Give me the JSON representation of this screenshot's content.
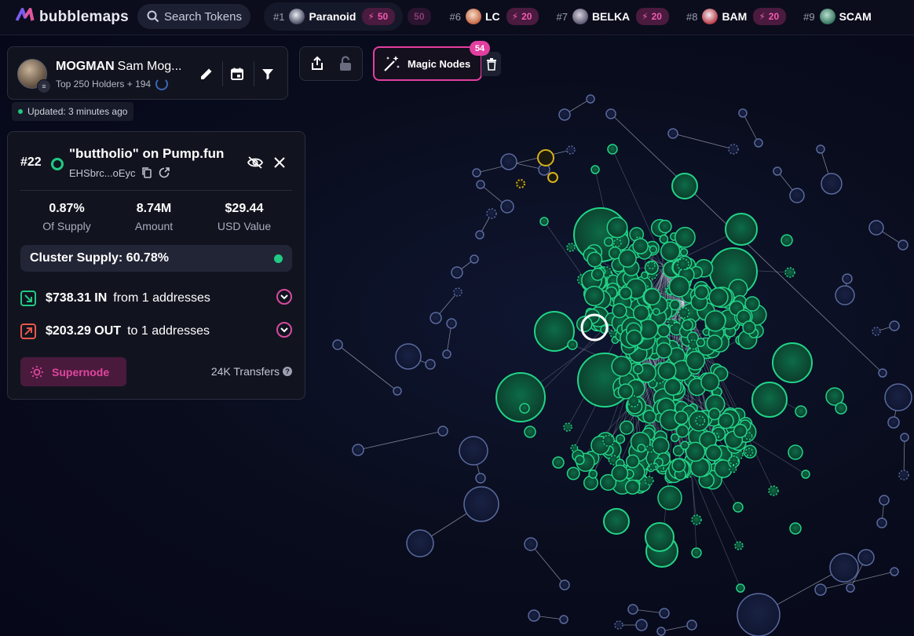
{
  "app": {
    "name": "bubblemaps"
  },
  "search": {
    "placeholder": "Search Tokens"
  },
  "ticker": [
    {
      "rank": "#1",
      "symbol": "Paranoid",
      "boost": "50",
      "ghost": "50",
      "avatar_color": "#dfe2ea"
    },
    {
      "rank": "#6",
      "symbol": "LC",
      "boost": "20",
      "avatar_color": "#f4d2b8"
    },
    {
      "rank": "#7",
      "symbol": "BELKA",
      "boost": "20",
      "avatar_color": "#c9c2d1"
    },
    {
      "rank": "#8",
      "symbol": "BAM",
      "boost": "20",
      "avatar_color": "#e8e2e6"
    },
    {
      "rank": "#9",
      "symbol": "SCAM",
      "boost": "",
      "avatar_color": "#7fb8a1"
    }
  ],
  "profile": {
    "name": "MOGMAN",
    "subtitle": "Sam Mog...",
    "holders_label": "Top 250 Holders + 194",
    "updated": "Updated: 3 minutes ago"
  },
  "magic_nodes": {
    "label": "Magic Nodes",
    "count": "54"
  },
  "detail": {
    "rank": "#22",
    "title": "\"buttholio\" on Pump.fun",
    "address": "EHSbrc...oEyc",
    "stats": [
      {
        "value": "0.87%",
        "label": "Of Supply"
      },
      {
        "value": "8.74M",
        "label": "Amount"
      },
      {
        "value": "$29.44",
        "label": "USD Value"
      }
    ],
    "cluster_supply": "Cluster Supply: 60.78%",
    "inflow": {
      "amount": "$738.31 IN",
      "text": "from 1 addresses"
    },
    "outflow": {
      "amount": "$203.29 OUT",
      "text": "to 1 addresses"
    },
    "supernode_label": "Supernode",
    "transfers": "24K Transfers"
  },
  "colors": {
    "accent": "#e23fa0",
    "cluster_green": "#21c983",
    "node_blue": "#1c2a52",
    "highlight_yellow": "#d8b21a",
    "bg": "#090c1c"
  },
  "icons": [
    "search-icon",
    "edit-icon",
    "calendar-icon",
    "filter-icon",
    "share-icon",
    "lock-icon",
    "wand-icon",
    "trash-icon",
    "hide-icon",
    "close-icon",
    "copy-icon",
    "external-link-icon",
    "inflow-icon",
    "outflow-icon",
    "chevron-down-icon",
    "sun-icon",
    "help-icon"
  ]
}
